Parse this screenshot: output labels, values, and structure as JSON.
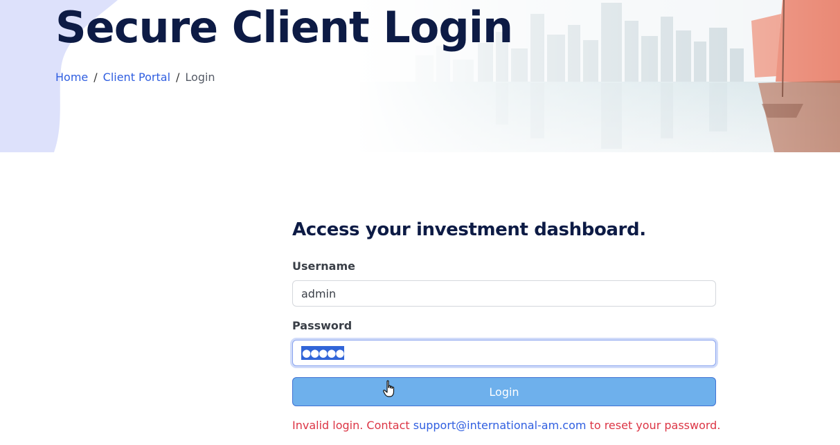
{
  "hero": {
    "title": "Secure Client Login",
    "breadcrumb": {
      "home": "Home",
      "portal": "Client Portal",
      "current": "Login",
      "separator": "/"
    }
  },
  "form": {
    "heading": "Access your investment dashboard.",
    "username_label": "Username",
    "username_value": "admin",
    "password_label": "Password",
    "password_mask": "●●●●●",
    "login_label": "Login"
  },
  "error": {
    "prefix": "Invalid login. Contact ",
    "email": "support@international-am.com",
    "suffix": " to reset your password."
  },
  "colors": {
    "brand_dark": "#0d1b45",
    "link": "#2f5ee0",
    "button": "#6eb0ec",
    "error": "#dc3545"
  }
}
